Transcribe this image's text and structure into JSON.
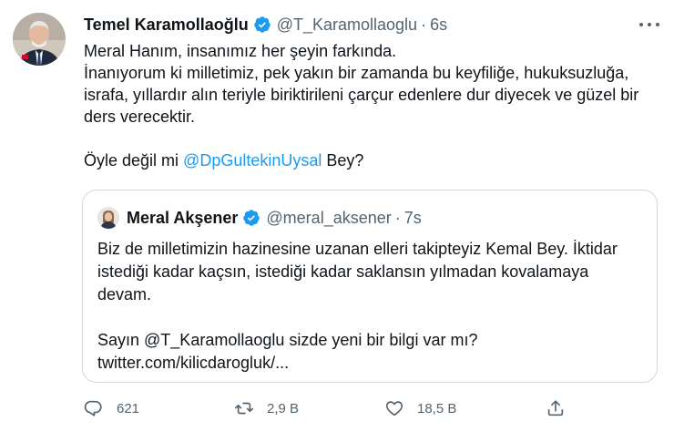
{
  "tweet": {
    "author": {
      "name": "Temel Karamollaoğlu",
      "handle": "@T_Karamollaoglu",
      "time": "6s"
    },
    "text": {
      "line1": "Meral Hanım, insanımız her şeyin farkında.",
      "line2": "İnanıyorum ki milletimiz, pek yakın bir zamanda bu keyfiliğe, hukuksuzluğa,",
      "line3": "israfa, yıllardır alın teriyle biriktirileni çarçur edenlere dur diyecek ve güzel bir",
      "line4": "ders verecektir.",
      "line5_prefix": "Öyle değil mi ",
      "line5_mention": "@DpGultekinUysal",
      "line5_suffix": " Bey?"
    },
    "quoted": {
      "author": {
        "name": "Meral Akşener",
        "handle": "@meral_aksener",
        "time": "7s"
      },
      "text": {
        "line1": "Biz de milletimizin hazinesine uzanan elleri takipteyiz Kemal Bey. İktidar",
        "line2": "istediği kadar kaçsın, istediği kadar saklansın yılmadan kovalamaya",
        "line3": "devam.",
        "line4": "Sayın @T_Karamollaoglu sizde yeni bir bilgi var mı?",
        "line5": "twitter.com/kilicdarogluk/..."
      }
    },
    "actions": {
      "replies": "621",
      "retweets": "2,9 B",
      "likes": "18,5 B"
    },
    "icons": {
      "verified": "verified-badge-icon",
      "more": "more-icon",
      "reply": "reply-icon",
      "retweet": "retweet-icon",
      "like": "heart-icon",
      "share": "share-icon"
    },
    "colors": {
      "text": "#0f1419",
      "secondary": "#536471",
      "link": "#1d9bf0",
      "verified": "#1d9bf0",
      "border": "#cfd9de"
    }
  }
}
